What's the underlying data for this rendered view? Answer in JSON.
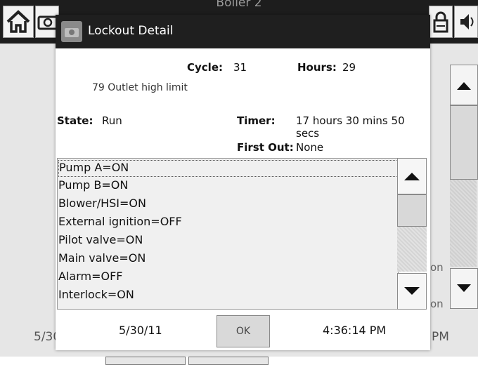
{
  "background": {
    "title": "Boiler 2",
    "date_fragment": "5/30",
    "on_label_1": "on",
    "on_label_2": "on",
    "pm_fragment": "PM"
  },
  "dialog": {
    "title": "Lockout Detail",
    "cycle_label": "Cycle:",
    "cycle_value": "31",
    "hours_label": "Hours:",
    "hours_value": "29",
    "lockout_message": "79 Outlet high limit",
    "state_label": "State:",
    "state_value": "Run",
    "timer_label": "Timer:",
    "timer_value": "17 hours 30 mins 50 secs",
    "first_out_label": "First Out:",
    "first_out_value": "None",
    "io_list": [
      "Pump A=ON",
      "Pump B=ON",
      "Blower/HSI=ON",
      "External ignition=OFF",
      "Pilot valve=ON",
      "Main valve=ON",
      "Alarm=OFF",
      "Interlock=ON"
    ],
    "ok_label": "OK",
    "footer_date": "5/30/11",
    "footer_time": "4:36:14 PM"
  },
  "icons": {
    "home": "home-icon",
    "camera": "camera-icon",
    "lock": "lock-icon",
    "sound": "speaker-icon",
    "up": "triangle-up-icon",
    "down": "triangle-down-icon"
  },
  "colors": {
    "titlebar": "#1f1f1f",
    "list_bg": "#f0f0f0",
    "button_bg": "#d9d9d9"
  }
}
